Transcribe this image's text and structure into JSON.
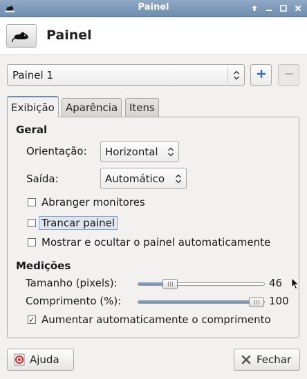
{
  "window": {
    "title": "Painel",
    "controls": [
      "up-icon",
      "minimize-icon",
      "maximize-icon",
      "close-icon"
    ]
  },
  "header": {
    "title": "Painel",
    "icon": "mouse-icon"
  },
  "panel_selector": {
    "selected": "Painel 1",
    "add_icon": "plus-icon",
    "remove_icon": "minus-icon"
  },
  "tabs": [
    {
      "label": "Exibição",
      "active": true
    },
    {
      "label": "Aparência",
      "active": false
    },
    {
      "label": "Itens",
      "active": false
    }
  ],
  "geral": {
    "title": "Geral",
    "orientacao": {
      "label": "Orientação:",
      "value": "Horizontal"
    },
    "saida": {
      "label": "Saída:",
      "value": "Automático"
    },
    "abranger": {
      "label": "Abranger monitores",
      "checked": false
    },
    "trancar": {
      "label": "Trancar painel",
      "checked": false
    },
    "mostrar": {
      "label": "Mostrar e ocultar o painel automaticamente",
      "checked": false
    }
  },
  "medicoes": {
    "title": "Medições",
    "tamanho": {
      "label": "Tamanho (pixels):",
      "value": "46",
      "fraction": 0.25
    },
    "comprimento": {
      "label": "Comprimento (%):",
      "value": "100",
      "fraction": 0.94
    },
    "aumentar": {
      "label": "Aumentar automaticamente o comprimento",
      "checked": true
    }
  },
  "buttons": {
    "help": "Ajuda",
    "close": "Fechar"
  },
  "colors": {
    "titlebar": "#7f9bbb",
    "accent": "#6a8bb5",
    "slider_fill": "#6f94c2"
  }
}
